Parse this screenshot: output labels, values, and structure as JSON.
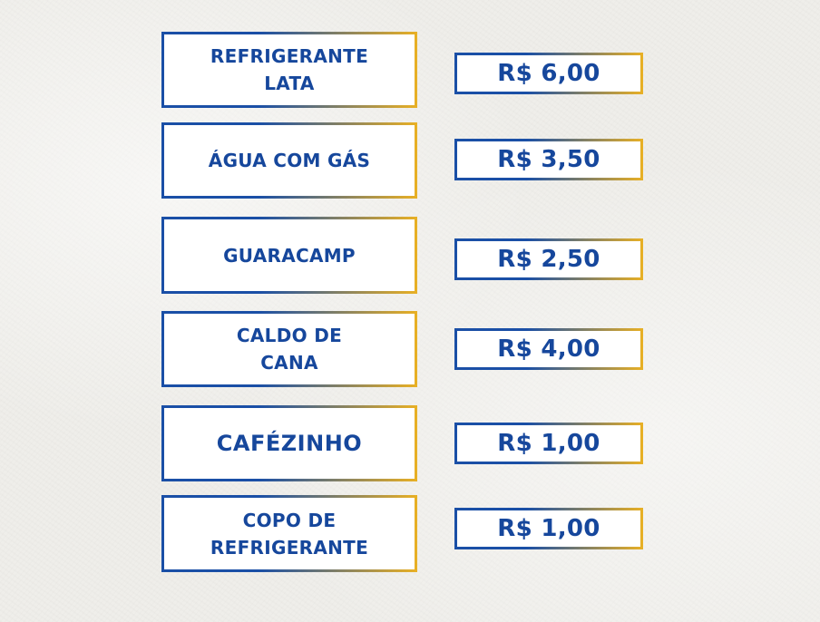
{
  "colors": {
    "text": "#16479c",
    "border_start": "#1a4fa6",
    "border_end": "#e9b024",
    "background": "#efeeea"
  },
  "items": [
    {
      "name": "REFRIGERANTE\nLATA",
      "price": "R$ 6,00"
    },
    {
      "name": "ÁGUA COM GÁS",
      "price": "R$ 3,50"
    },
    {
      "name": "GUARACAMP",
      "price": "R$ 2,50"
    },
    {
      "name": "CALDO DE\nCANA",
      "price": "R$ 4,00"
    },
    {
      "name": "CAFÉZINHO",
      "price": "R$ 1,00"
    },
    {
      "name": "COPO DE\nREFRIGERANTE",
      "price": "R$ 1,00"
    }
  ]
}
